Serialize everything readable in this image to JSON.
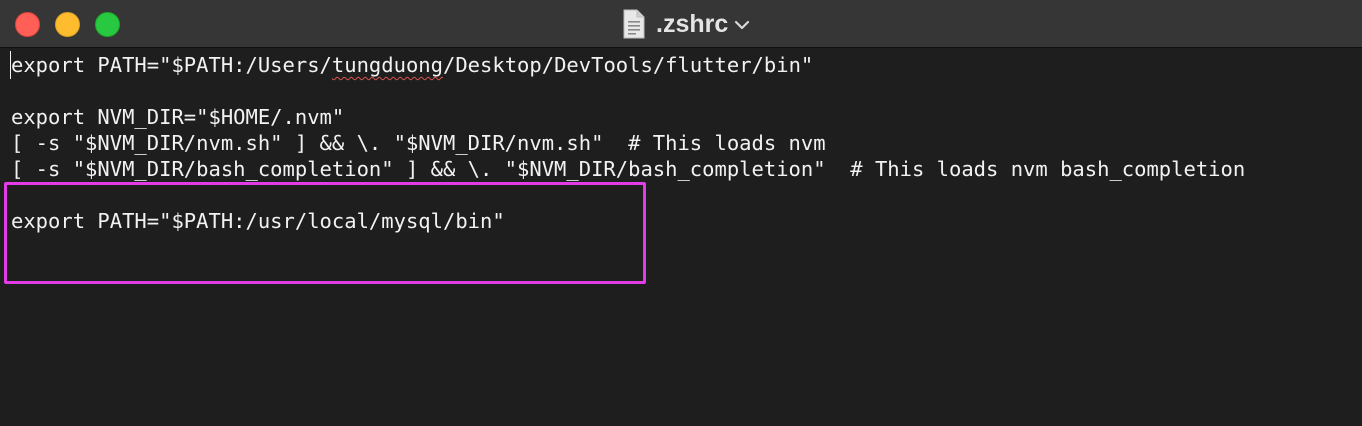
{
  "window": {
    "title": ".zshrc",
    "icons": {
      "document": "document-icon",
      "dropdown": "chevron-down-icon"
    }
  },
  "editor": {
    "lines": {
      "line1": {
        "before": "export PATH=\"$PATH:/Users/",
        "misspelled": "tungduong",
        "after": "/Desktop/DevTools/flutter/bin\""
      },
      "line3": "export NVM_DIR=\"$HOME/.nvm\"",
      "line4": "[ -s \"$NVM_DIR/nvm.sh\" ] && \\. \"$NVM_DIR/nvm.sh\"  # This loads nvm",
      "line5": "[ -s \"$NVM_DIR/bash_completion\" ] && \\. \"$NVM_DIR/bash_completion\"  # This loads nvm bash_completion",
      "line7": "export PATH=\"$PATH:/usr/local/mysql/bin\""
    }
  },
  "colors": {
    "highlight": "#e23ce6",
    "background": "#1e1e1e",
    "titlebar": "#363636"
  }
}
